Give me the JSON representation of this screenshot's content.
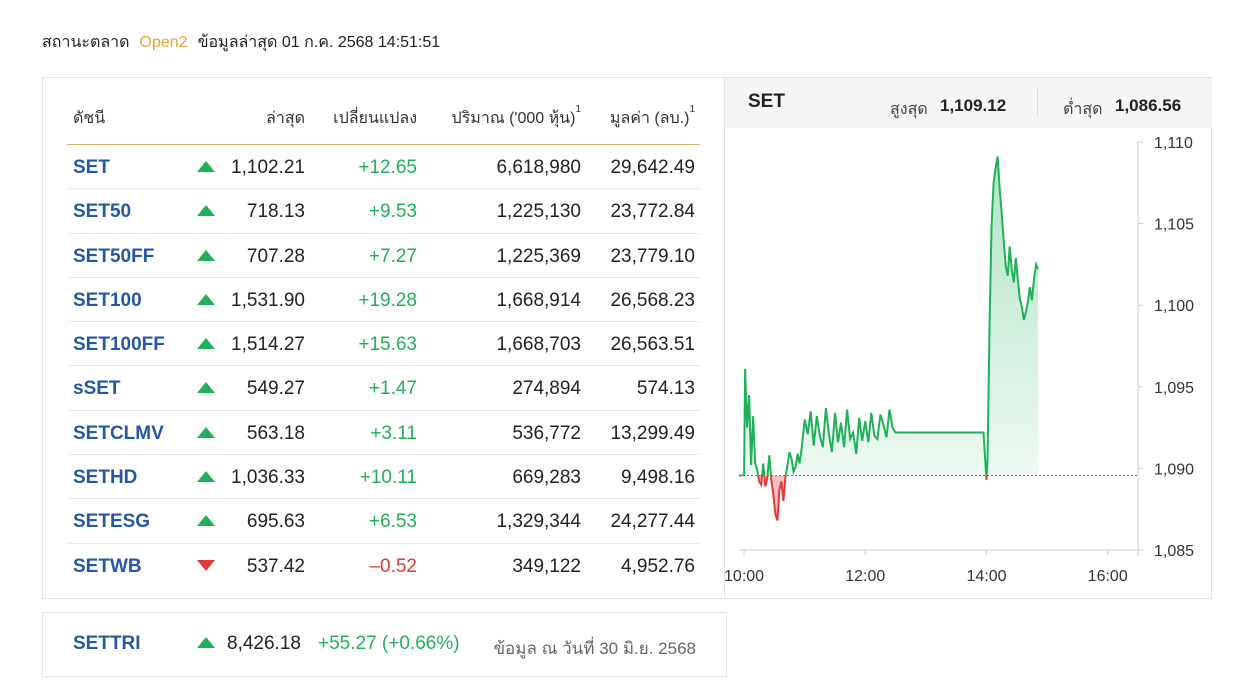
{
  "status": {
    "label": "สถานะตลาด",
    "state": "Open2",
    "updated": "ข้อมูลล่าสุด 01 ก.ค. 2568 14:51:51"
  },
  "table": {
    "headers": {
      "name": "ดัชนี",
      "last": "ล่าสุด",
      "change": "เปลี่ยนแปลง",
      "volume": "ปริมาณ ('000 หุ้น)",
      "value": "มูลค่า (ลบ.)",
      "footnote": "1"
    },
    "rows": [
      {
        "name": "SET",
        "dir": "up",
        "last": "1,102.21",
        "change": "+12.65",
        "volume": "6,618,980",
        "value": "29,642.49"
      },
      {
        "name": "SET50",
        "dir": "up",
        "last": "718.13",
        "change": "+9.53",
        "volume": "1,225,130",
        "value": "23,772.84"
      },
      {
        "name": "SET50FF",
        "dir": "up",
        "last": "707.28",
        "change": "+7.27",
        "volume": "1,225,369",
        "value": "23,779.10"
      },
      {
        "name": "SET100",
        "dir": "up",
        "last": "1,531.90",
        "change": "+19.28",
        "volume": "1,668,914",
        "value": "26,568.23"
      },
      {
        "name": "SET100FF",
        "dir": "up",
        "last": "1,514.27",
        "change": "+15.63",
        "volume": "1,668,703",
        "value": "26,563.51"
      },
      {
        "name": "sSET",
        "dir": "up",
        "last": "549.27",
        "change": "+1.47",
        "volume": "274,894",
        "value": "574.13"
      },
      {
        "name": "SETCLMV",
        "dir": "up",
        "last": "563.18",
        "change": "+3.11",
        "volume": "536,772",
        "value": "13,299.49"
      },
      {
        "name": "SETHD",
        "dir": "up",
        "last": "1,036.33",
        "change": "+10.11",
        "volume": "669,283",
        "value": "9,498.16"
      },
      {
        "name": "SETESG",
        "dir": "up",
        "last": "695.63",
        "change": "+6.53",
        "volume": "1,329,344",
        "value": "24,277.44"
      },
      {
        "name": "SETWB",
        "dir": "down",
        "last": "537.42",
        "change": "–0.52",
        "volume": "349,122",
        "value": "4,952.76"
      }
    ]
  },
  "chart": {
    "title": "SET",
    "high_label": "สูงสุด",
    "high_value": "1,109.12",
    "low_label": "ต่ำสุด",
    "low_value": "1,086.56"
  },
  "chart_data": {
    "type": "line",
    "title": "SET",
    "xlabel": "",
    "ylabel": "",
    "x_ticks": [
      "10:00",
      "12:00",
      "14:00",
      "16:00"
    ],
    "y_ticks": [
      "1,085",
      "1,090",
      "1,095",
      "1,100",
      "1,105",
      "1,110"
    ],
    "xlim": [
      "09:55",
      "16:30"
    ],
    "ylim": [
      1085,
      1110
    ],
    "baseline": 1089.56,
    "grid": false,
    "colors": {
      "up": "#1fb15a",
      "down": "#e23a3a",
      "baseline": "#666666"
    },
    "series": [
      {
        "x": [
          "09:55",
          "10:00",
          "10:01",
          "10:03",
          "10:05",
          "10:07",
          "10:09",
          "10:11",
          "10:13",
          "10:15",
          "10:17",
          "10:19",
          "10:21",
          "10:23",
          "10:25",
          "10:27",
          "10:29",
          "10:31",
          "10:33",
          "10:35",
          "10:37",
          "10:39",
          "10:41",
          "10:43",
          "10:45",
          "10:47",
          "10:49",
          "10:51",
          "10:53",
          "10:55",
          "10:57",
          "11:00",
          "11:03",
          "11:06",
          "11:09",
          "11:12",
          "11:15",
          "11:18",
          "11:21",
          "11:24",
          "11:27",
          "11:30",
          "11:33",
          "11:36",
          "11:39",
          "11:42",
          "11:45",
          "11:48",
          "11:51",
          "11:54",
          "11:57",
          "12:00",
          "12:03",
          "12:06",
          "12:09",
          "12:12",
          "12:15",
          "12:18",
          "12:21",
          "12:24",
          "12:27",
          "12:30",
          "13:00",
          "13:30",
          "13:57",
          "14:00",
          "14:01",
          "14:03",
          "14:05",
          "14:07",
          "14:09",
          "14:11",
          "14:13",
          "14:15",
          "14:17",
          "14:19",
          "14:21",
          "14:23",
          "14:25",
          "14:27",
          "14:29",
          "14:31",
          "14:33",
          "14:35",
          "14:37",
          "14:39",
          "14:41",
          "14:43",
          "14:45",
          "14:47",
          "14:49",
          "14:51"
        ],
        "y": [
          1089.56,
          1089.6,
          1096.1,
          1092.5,
          1094.5,
          1090.2,
          1093.2,
          1090.3,
          1089.9,
          1089.2,
          1089.0,
          1090.3,
          1088.9,
          1089.4,
          1090.8,
          1089.3,
          1088.4,
          1087.2,
          1086.8,
          1088.7,
          1089.2,
          1088.0,
          1089.5,
          1090.2,
          1091.0,
          1090.6,
          1089.8,
          1090.1,
          1090.9,
          1090.3,
          1091.2,
          1093.0,
          1092.1,
          1093.5,
          1091.4,
          1093.2,
          1092.0,
          1091.3,
          1093.7,
          1092.1,
          1091.0,
          1093.4,
          1091.6,
          1092.8,
          1091.3,
          1093.6,
          1091.8,
          1092.2,
          1090.9,
          1093.1,
          1091.7,
          1092.9,
          1091.6,
          1093.4,
          1092.0,
          1091.8,
          1093.3,
          1092.7,
          1091.9,
          1093.6,
          1092.5,
          1092.2,
          1092.2,
          1092.2,
          1092.2,
          1089.3,
          1090.5,
          1098.5,
          1104.8,
          1107.5,
          1108.4,
          1109.12,
          1107.2,
          1105.7,
          1104.0,
          1102.4,
          1101.8,
          1103.6,
          1102.2,
          1101.4,
          1102.9,
          1101.6,
          1100.4,
          1099.9,
          1099.1,
          1099.6,
          1100.2,
          1101.1,
          1100.3,
          1101.6,
          1102.5,
          1102.21
        ]
      }
    ]
  },
  "tri": {
    "name": "SETTRI",
    "dir": "up",
    "last": "8,426.18",
    "change": "+55.27 (+0.66%)",
    "date": "ข้อมูล ณ วันที่ 30 มิ.ย. 2568"
  }
}
